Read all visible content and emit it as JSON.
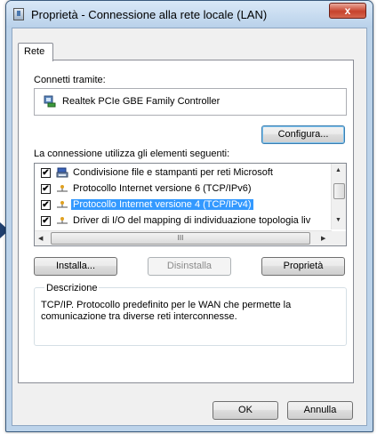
{
  "window": {
    "title": "Proprietà - Connessione alla rete locale (LAN)",
    "close_label": "x"
  },
  "tabs": [
    {
      "label": "Rete"
    }
  ],
  "connect_via": {
    "label": "Connetti tramite:",
    "adapter_name": "Realtek PCIe GBE Family Controller",
    "configure_label": "Configura..."
  },
  "items_section": {
    "label": "La connessione utilizza gli elementi seguenti:",
    "items": [
      {
        "label": "Condivisione file e stampanti per reti Microsoft",
        "checked": true,
        "selected": false,
        "icon": "printer-share-icon"
      },
      {
        "label": "Protocollo Internet versione 6 (TCP/IPv6)",
        "checked": true,
        "selected": false,
        "icon": "protocol-icon"
      },
      {
        "label": "Protocollo Internet versione 4 (TCP/IPv4)",
        "checked": true,
        "selected": true,
        "icon": "protocol-icon"
      },
      {
        "label": "Driver di I/O del mapping di individuazione topologia liv",
        "checked": true,
        "selected": false,
        "icon": "protocol-icon"
      }
    ],
    "hscroll_thumb_label": "III"
  },
  "buttons": {
    "install": "Installa...",
    "uninstall": "Disinstalla",
    "properties": "Proprietà",
    "ok": "OK",
    "cancel": "Annulla"
  },
  "description": {
    "legend": "Descrizione",
    "text": "TCP/IP. Protocollo predefinito per le WAN che permette la comunicazione tra diverse reti interconnesse."
  },
  "colors": {
    "selection": "#3399ff",
    "title_bar": "#bcd3ea",
    "close_button": "#c7422c"
  }
}
